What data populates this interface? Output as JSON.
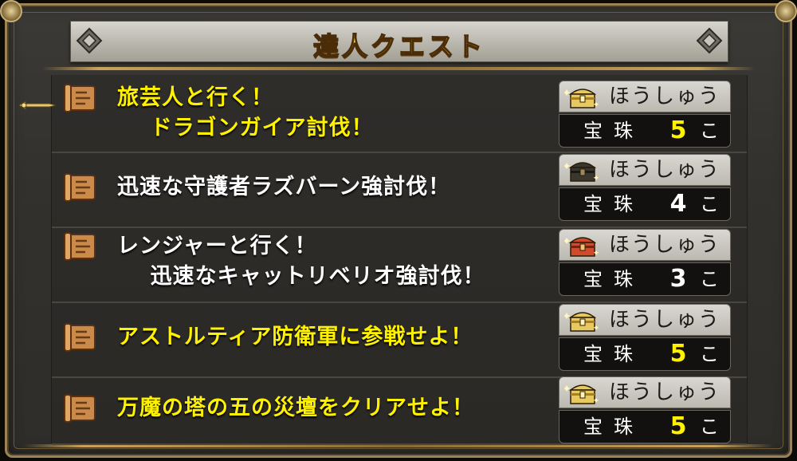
{
  "window": {
    "title": "達人クエスト"
  },
  "quests": [
    {
      "title": "旅芸人と行く！\n    ドラゴンガイア討伐！",
      "title_color": "yellow",
      "reward_label": "ほうしゅう",
      "chest": "gold-chest-icon",
      "item": "宝珠",
      "quantity": "5",
      "unit": "こ",
      "selected": true
    },
    {
      "title": "迅速な守護者ラズバーン強討伐！",
      "title_color": "white",
      "reward_label": "ほうしゅう",
      "chest": "black-chest-icon",
      "item": "宝珠",
      "quantity": "4",
      "unit": "こ",
      "selected": false
    },
    {
      "title": "レンジャーと行く！\n    迅速なキャットリベリオ強討伐！",
      "title_color": "white",
      "reward_label": "ほうしゅう",
      "chest": "red-chest-icon",
      "item": "宝珠",
      "quantity": "3",
      "unit": "こ",
      "selected": false
    },
    {
      "title": "アストルティア防衛軍に参戦せよ！",
      "title_color": "yellow",
      "reward_label": "ほうしゅう",
      "chest": "gold-chest-icon",
      "item": "宝珠",
      "quantity": "5",
      "unit": "こ",
      "selected": false
    },
    {
      "title": "万魔の塔の五の災壇をクリアせよ！",
      "title_color": "yellow",
      "reward_label": "ほうしゅう",
      "chest": "gold-chest-icon",
      "item": "宝珠",
      "quantity": "5",
      "unit": "こ",
      "selected": false
    }
  ],
  "colors": {
    "highlight_yellow": "#fff200",
    "normal_white": "#ffffff",
    "title_gold": "#f3d24a",
    "frame_gold": "#9c8356"
  }
}
